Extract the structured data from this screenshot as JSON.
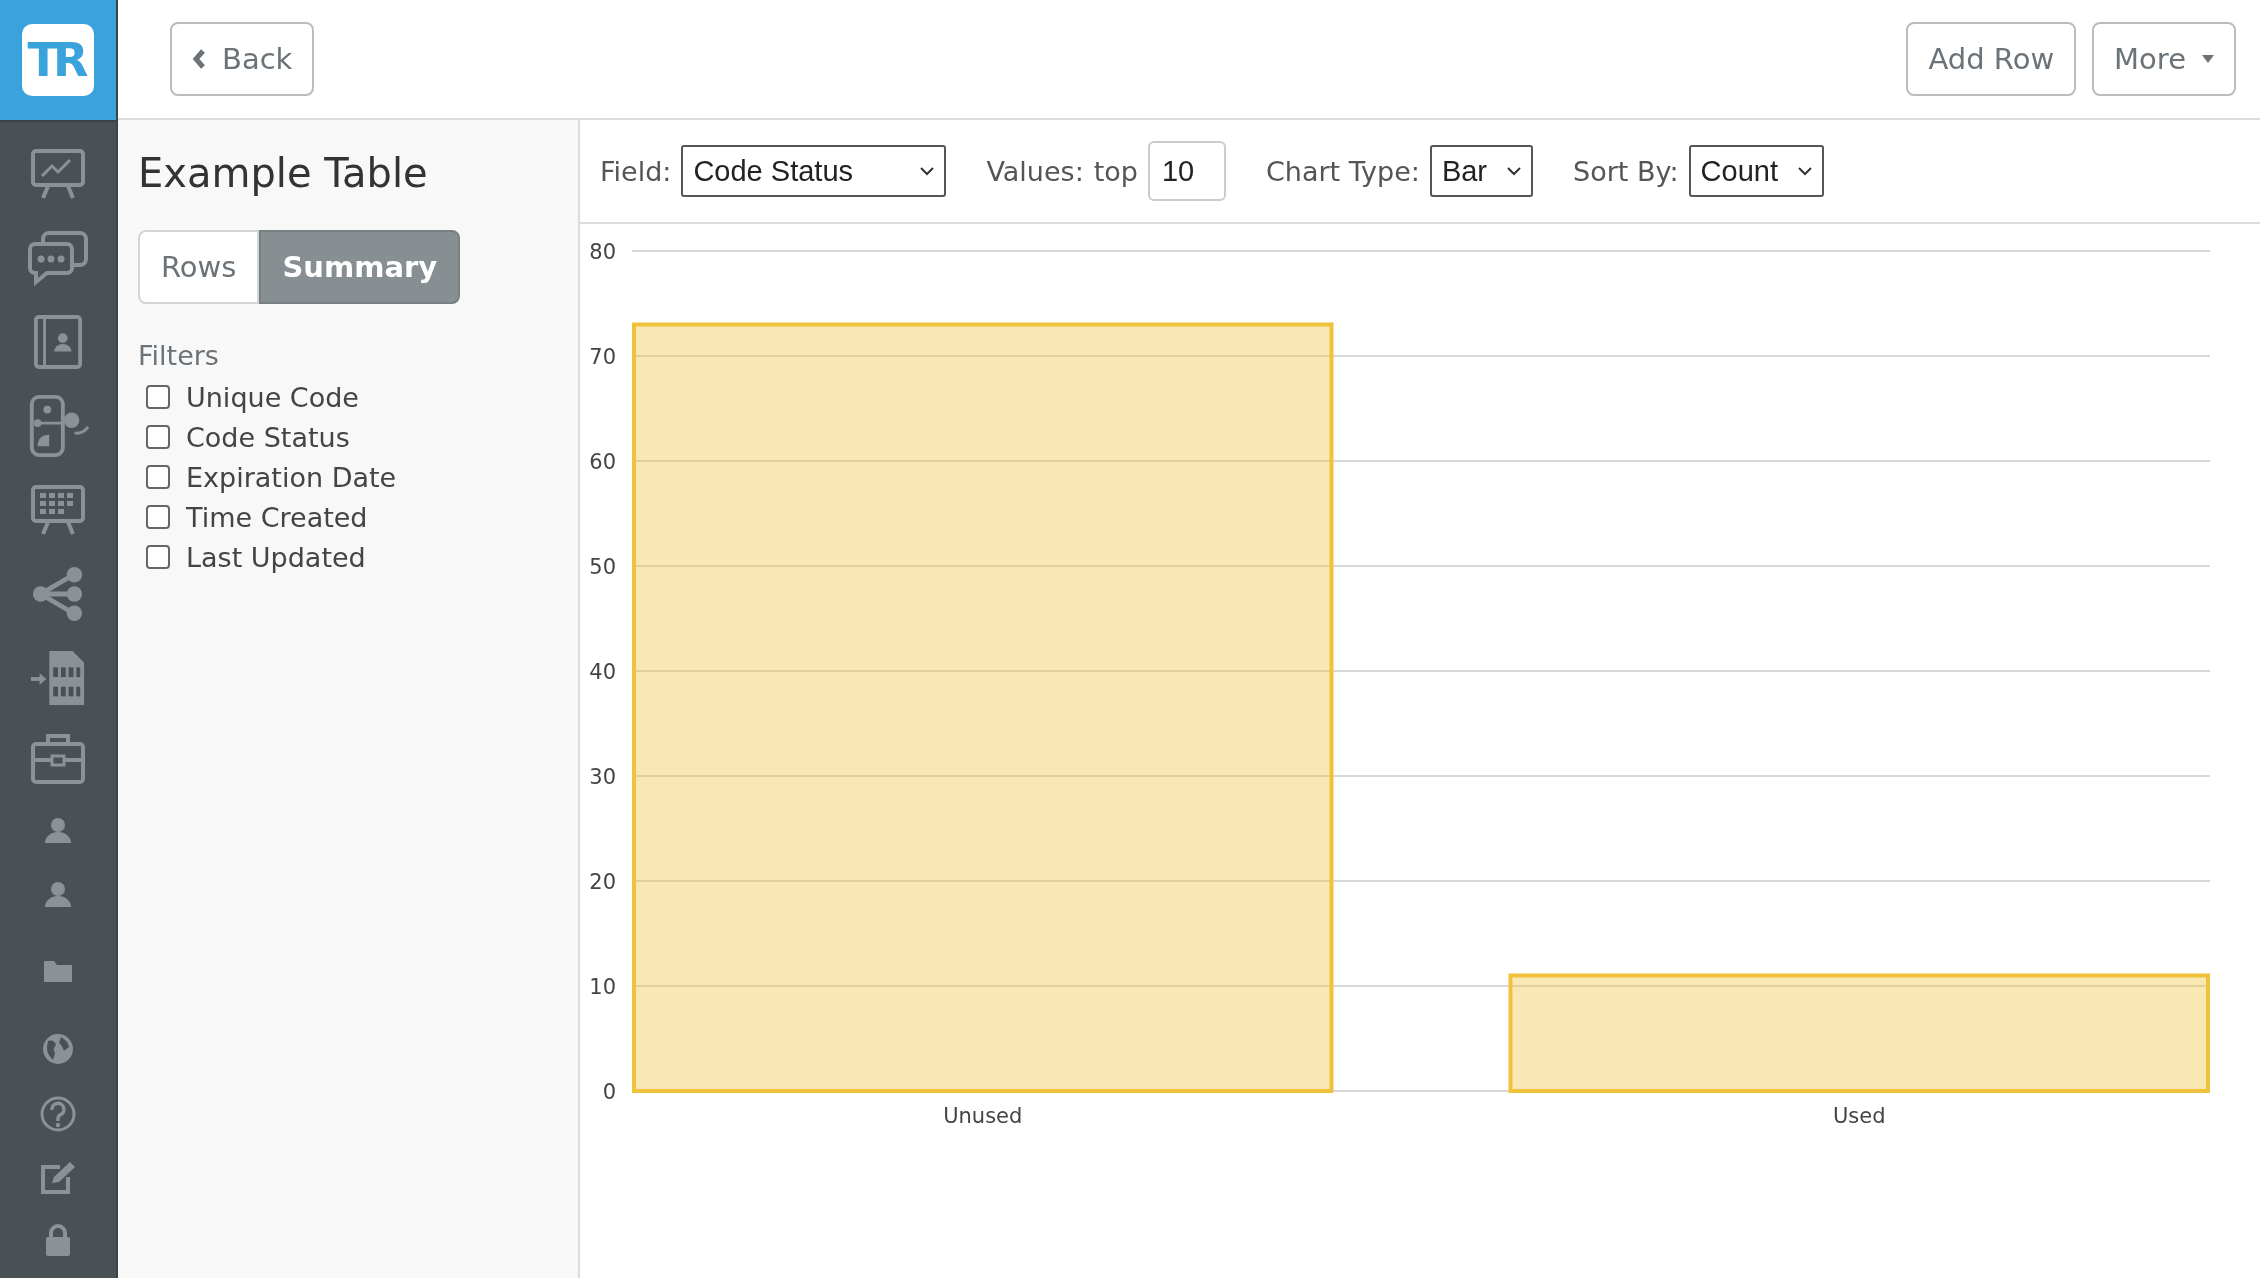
{
  "logo": {
    "text": "TR"
  },
  "header": {
    "back_button": "Back",
    "actions": [
      {
        "label": "Add Row",
        "dropdown": false
      },
      {
        "label": "More",
        "dropdown": true
      }
    ]
  },
  "panel": {
    "title": "Example Table",
    "tabs": [
      {
        "label": "Rows",
        "selected": false
      },
      {
        "label": "Summary",
        "selected": true
      }
    ],
    "filters_label": "Filters",
    "filters": [
      {
        "label": "Unique Code",
        "checked": false
      },
      {
        "label": "Code Status",
        "checked": false
      },
      {
        "label": "Expiration Date",
        "checked": false
      },
      {
        "label": "Time Created",
        "checked": false
      },
      {
        "label": "Last Updated",
        "checked": false
      }
    ]
  },
  "toolbar": [
    {
      "kind": "select",
      "label": "Field:",
      "value": "Code Status"
    },
    {
      "kind": "number",
      "label": "Values:",
      "prefix": "top",
      "value": "10"
    },
    {
      "kind": "select",
      "label": "Chart Type:",
      "value": "Bar"
    },
    {
      "kind": "select",
      "label": "Sort By:",
      "value": "Count"
    }
  ],
  "chart": {
    "chart_data": {
      "type": "bar",
      "categories": [
        "Unused",
        "Used"
      ],
      "series": [
        {
          "color": "#f0c23b",
          "values": [
            73,
            11
          ]
        }
      ],
      "grid": true,
      "ylim": [
        0,
        80
      ],
      "yticks": [
        0,
        10,
        20,
        30,
        40,
        50,
        60,
        70,
        80
      ]
    }
  }
}
